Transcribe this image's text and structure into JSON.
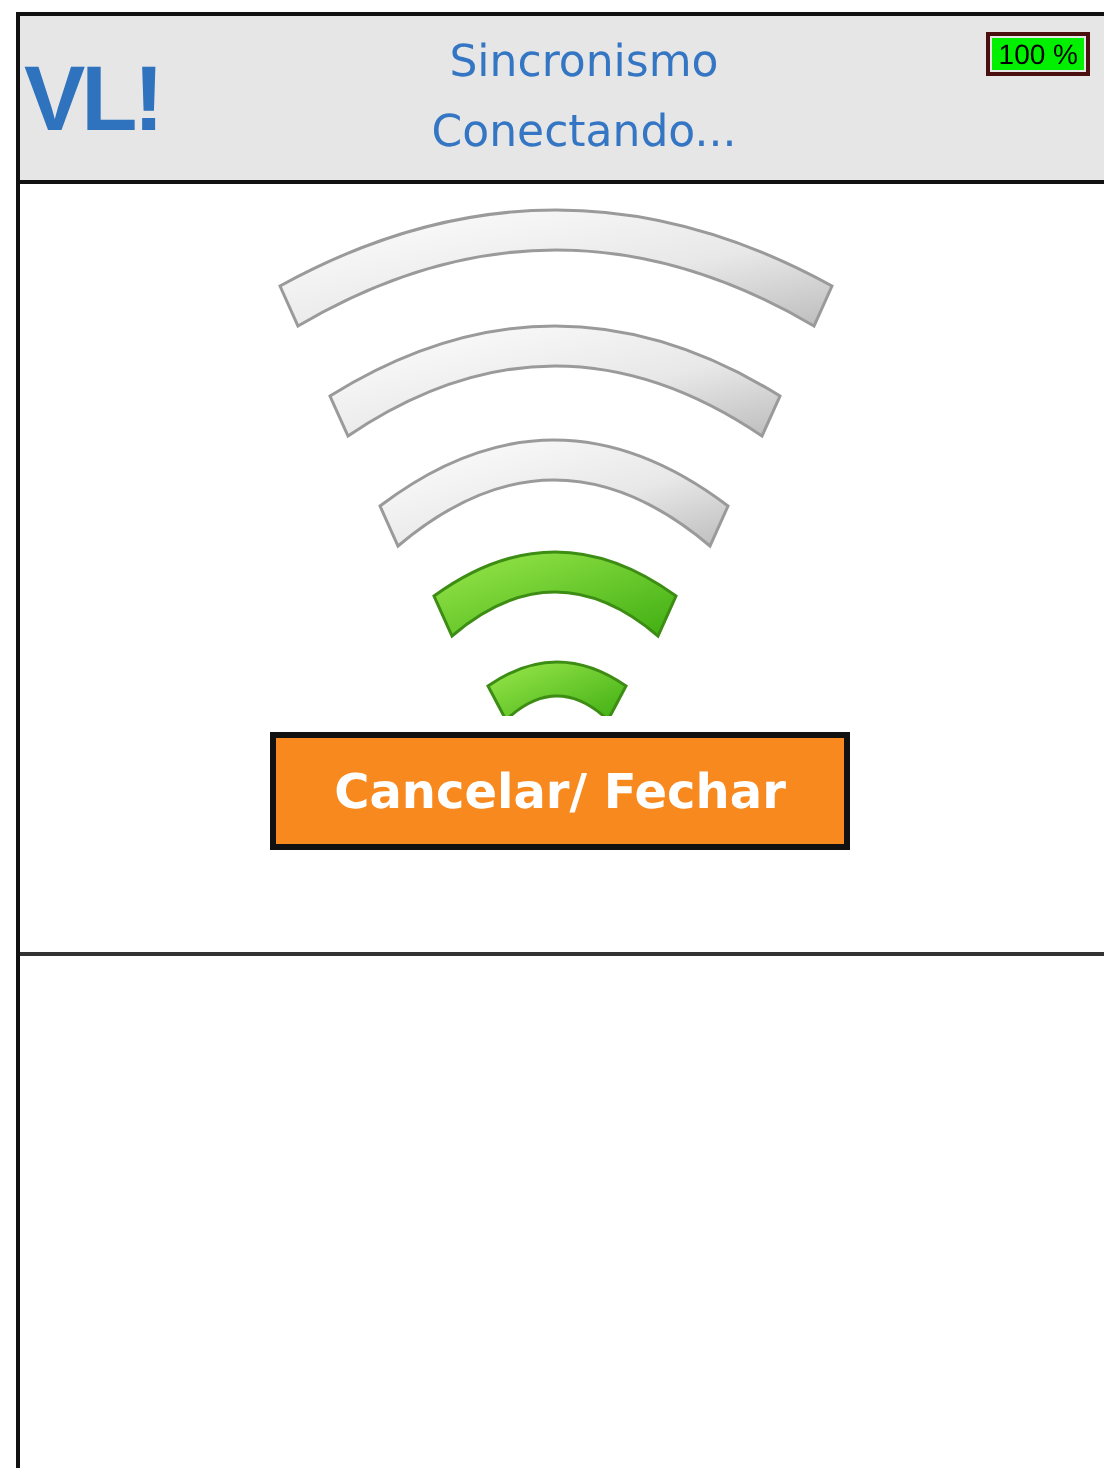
{
  "header": {
    "logo": "VL!",
    "title": "Sincronismo",
    "status": "Conectando...",
    "battery": "100 %"
  },
  "button": {
    "label": "Cancelar/ Fechar"
  }
}
